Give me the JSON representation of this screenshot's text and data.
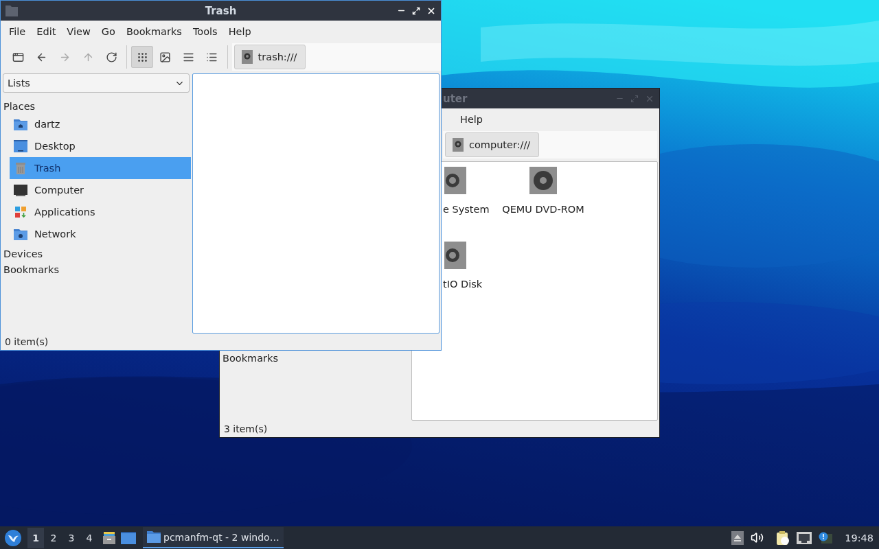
{
  "back_window": {
    "title": "uter",
    "menu": [
      "Help"
    ],
    "location": "computer:///",
    "items": [
      {
        "label": "e System",
        "kind": "clipped"
      },
      {
        "label": "QEMU DVD-ROM",
        "kind": "full"
      },
      {
        "label": "tIO Disk",
        "kind": "clipped"
      }
    ],
    "sidebar_sections": [
      "Bookmarks"
    ],
    "status": "3 item(s)"
  },
  "front_window": {
    "title": "Trash",
    "menu": [
      "File",
      "Edit",
      "View",
      "Go",
      "Bookmarks",
      "Tools",
      "Help"
    ],
    "nav_buttons": [
      {
        "kind": "new-tab",
        "disabled": false
      },
      {
        "kind": "back",
        "disabled": false
      },
      {
        "kind": "forward",
        "disabled": true
      },
      {
        "kind": "up",
        "disabled": true
      },
      {
        "kind": "reload",
        "disabled": false
      }
    ],
    "view_modes": [
      {
        "kind": "icons",
        "selected": true
      },
      {
        "kind": "thumbnails",
        "selected": false
      },
      {
        "kind": "compact",
        "selected": false
      },
      {
        "kind": "details",
        "selected": false
      }
    ],
    "location": "trash:///",
    "sidebar": {
      "dropdown": "Lists",
      "sections": [
        {
          "title": "Places",
          "items": [
            {
              "label": "dartz",
              "kind": "home",
              "selected": false
            },
            {
              "label": "Desktop",
              "kind": "desktop",
              "selected": false
            },
            {
              "label": "Trash",
              "kind": "trash",
              "selected": true
            },
            {
              "label": "Computer",
              "kind": "computer",
              "selected": false
            },
            {
              "label": "Applications",
              "kind": "apps",
              "selected": false
            },
            {
              "label": "Network",
              "kind": "network",
              "selected": false
            }
          ]
        },
        {
          "title": "Devices"
        },
        {
          "title": "Bookmarks"
        }
      ]
    },
    "status": "0 item(s)"
  },
  "taskbar": {
    "workspaces": [
      {
        "label": "1",
        "selected": true
      },
      {
        "label": "2",
        "selected": false
      },
      {
        "label": "3",
        "selected": false
      },
      {
        "label": "4",
        "selected": false
      }
    ],
    "tasks": [
      {
        "label": "pcmanfm-qt - 2 windo…",
        "selected": true
      }
    ],
    "clock": "19:48"
  }
}
